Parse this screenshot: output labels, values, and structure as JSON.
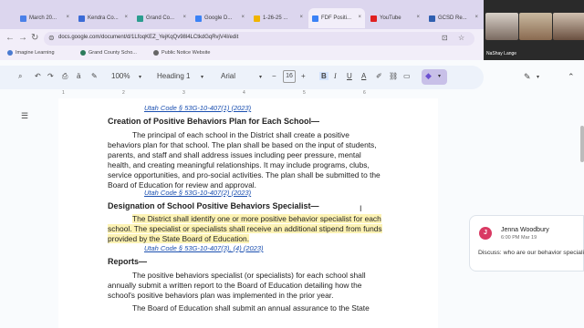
{
  "tabs": [
    {
      "label": "March 20...",
      "fav": "#4a80e8"
    },
    {
      "label": "Kendra Co...",
      "fav": "#3b6bd6"
    },
    {
      "label": "Grand Co...",
      "fav": "#2b9d8f"
    },
    {
      "label": "Google D...",
      "fav": "#3b82f6"
    },
    {
      "label": "1-26-25 ...",
      "fav": "#f0b400"
    },
    {
      "label": "FDF Positi...",
      "fav": "#3b82f6"
    },
    {
      "label": "YouTube",
      "fav": "#e02020"
    },
    {
      "label": "GCSD Re...",
      "fav": "#2f5fb0"
    }
  ],
  "address": {
    "url": "docs.google.com/document/d/1LfoqKEZ_YejKqQv98l4LCtkdGqRvjV4I/edit"
  },
  "bookmarks": [
    {
      "label": "Imagine Learning",
      "color": "#4a7bd0"
    },
    {
      "label": "Grand County Scho...",
      "color": "#2b7b5a"
    },
    {
      "label": "Public Notice Website",
      "color": "#666666"
    }
  ],
  "toolbar": {
    "zoom": "100%",
    "style": "Heading 1",
    "font": "Arial",
    "font_size": "16",
    "minus": "−",
    "plus": "+"
  },
  "ruler": [
    "1",
    "2",
    "3",
    "4",
    "5",
    "6"
  ],
  "document": {
    "lines": [
      {
        "text": "Utah Code § 53G-10-407(1) (2023)",
        "kind": "link",
        "indent": 40
      },
      {
        "text": "Creation of Positive Behaviors Plan for Each School—",
        "kind": "heading",
        "indent": 0
      },
      {
        "text": "The principal of each school in the District shall create a positive",
        "kind": "body",
        "indent": 27
      },
      {
        "text": "behaviors plan for that school. The plan shall be based on the input of students,",
        "kind": "body-under-first",
        "indent": 0,
        "underline": "behaviors"
      },
      {
        "text": "parents, and staff and shall address issues including peer pressure, mental",
        "kind": "body",
        "indent": 0
      },
      {
        "text": "health, and creating meaningful relationships. It may include programs, clubs,",
        "kind": "body",
        "indent": 0
      },
      {
        "text": "service opportunities, and pro-social activities. The plan shall be submitted to the",
        "kind": "body",
        "indent": 0
      },
      {
        "text": "Board of Education for review and approval.",
        "kind": "body",
        "indent": 0
      },
      {
        "text": "Utah Code § 53G-10-407(2) (2023)",
        "kind": "link",
        "indent": 40
      },
      {
        "text": "Designation of School Positive Behaviors Specialist—",
        "kind": "heading",
        "indent": 0
      },
      {
        "text": "The District shall identify one or more positive behavior specialist for each",
        "kind": "highlight",
        "indent": 27
      },
      {
        "text": "school. The specialist or specialists shall receive an additional stipend from funds",
        "kind": "highlight",
        "indent": 0
      },
      {
        "text": "provided by the State Board of Education.",
        "kind": "highlight",
        "indent": 0
      },
      {
        "text": "Utah Code § 53G-10-407(3), (4) (2023)",
        "kind": "link",
        "indent": 40
      },
      {
        "text": "Reports—",
        "kind": "heading",
        "indent": 0
      },
      {
        "text": "The positive behaviors specialist (or specialists) for each school shall",
        "kind": "body",
        "indent": 27
      },
      {
        "text": "annually submit a written report to the Board of Education detailing how the",
        "kind": "body",
        "indent": 0
      },
      {
        "text": "school's positive behaviors plan was implemented in the prior year.",
        "kind": "body",
        "indent": 0
      },
      {
        "text": "The Board of Education shall submit an annual assurance to the State",
        "kind": "body",
        "indent": 27
      }
    ]
  },
  "comment": {
    "initial": "J",
    "author": "Jenna Woodbury",
    "time": "6:00 PM Mar 19",
    "text": "Discuss: who are our behavior specialists for each GC schoo"
  },
  "video": {
    "participant": "NaShay Lange"
  },
  "colors": {
    "tabbar": "#dcd6ee",
    "highlight": "#fdf3b5",
    "link": "#1a4fb0",
    "avatar": "#d93a63"
  }
}
